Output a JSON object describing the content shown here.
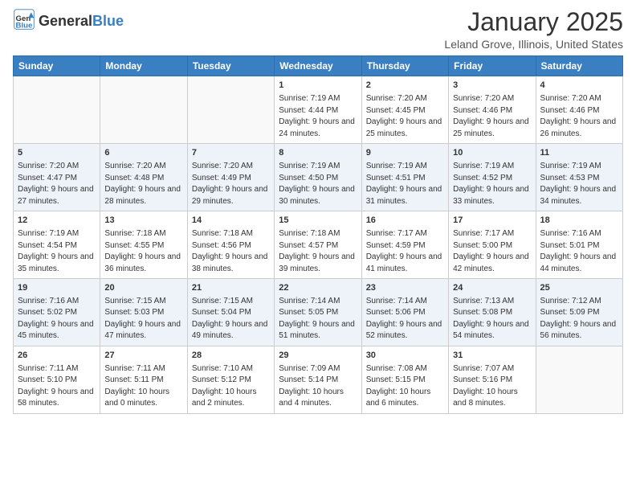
{
  "logo": {
    "general": "General",
    "blue": "Blue"
  },
  "header": {
    "month": "January 2025",
    "location": "Leland Grove, Illinois, United States"
  },
  "weekdays": [
    "Sunday",
    "Monday",
    "Tuesday",
    "Wednesday",
    "Thursday",
    "Friday",
    "Saturday"
  ],
  "weeks": [
    [
      {
        "day": "",
        "sunrise": "",
        "sunset": "",
        "daylight": "",
        "empty": true
      },
      {
        "day": "",
        "sunrise": "",
        "sunset": "",
        "daylight": "",
        "empty": true
      },
      {
        "day": "",
        "sunrise": "",
        "sunset": "",
        "daylight": "",
        "empty": true
      },
      {
        "day": "1",
        "sunrise": "Sunrise: 7:19 AM",
        "sunset": "Sunset: 4:44 PM",
        "daylight": "Daylight: 9 hours and 24 minutes.",
        "empty": false
      },
      {
        "day": "2",
        "sunrise": "Sunrise: 7:20 AM",
        "sunset": "Sunset: 4:45 PM",
        "daylight": "Daylight: 9 hours and 25 minutes.",
        "empty": false
      },
      {
        "day": "3",
        "sunrise": "Sunrise: 7:20 AM",
        "sunset": "Sunset: 4:46 PM",
        "daylight": "Daylight: 9 hours and 25 minutes.",
        "empty": false
      },
      {
        "day": "4",
        "sunrise": "Sunrise: 7:20 AM",
        "sunset": "Sunset: 4:46 PM",
        "daylight": "Daylight: 9 hours and 26 minutes.",
        "empty": false
      }
    ],
    [
      {
        "day": "5",
        "sunrise": "Sunrise: 7:20 AM",
        "sunset": "Sunset: 4:47 PM",
        "daylight": "Daylight: 9 hours and 27 minutes.",
        "empty": false
      },
      {
        "day": "6",
        "sunrise": "Sunrise: 7:20 AM",
        "sunset": "Sunset: 4:48 PM",
        "daylight": "Daylight: 9 hours and 28 minutes.",
        "empty": false
      },
      {
        "day": "7",
        "sunrise": "Sunrise: 7:20 AM",
        "sunset": "Sunset: 4:49 PM",
        "daylight": "Daylight: 9 hours and 29 minutes.",
        "empty": false
      },
      {
        "day": "8",
        "sunrise": "Sunrise: 7:19 AM",
        "sunset": "Sunset: 4:50 PM",
        "daylight": "Daylight: 9 hours and 30 minutes.",
        "empty": false
      },
      {
        "day": "9",
        "sunrise": "Sunrise: 7:19 AM",
        "sunset": "Sunset: 4:51 PM",
        "daylight": "Daylight: 9 hours and 31 minutes.",
        "empty": false
      },
      {
        "day": "10",
        "sunrise": "Sunrise: 7:19 AM",
        "sunset": "Sunset: 4:52 PM",
        "daylight": "Daylight: 9 hours and 33 minutes.",
        "empty": false
      },
      {
        "day": "11",
        "sunrise": "Sunrise: 7:19 AM",
        "sunset": "Sunset: 4:53 PM",
        "daylight": "Daylight: 9 hours and 34 minutes.",
        "empty": false
      }
    ],
    [
      {
        "day": "12",
        "sunrise": "Sunrise: 7:19 AM",
        "sunset": "Sunset: 4:54 PM",
        "daylight": "Daylight: 9 hours and 35 minutes.",
        "empty": false
      },
      {
        "day": "13",
        "sunrise": "Sunrise: 7:18 AM",
        "sunset": "Sunset: 4:55 PM",
        "daylight": "Daylight: 9 hours and 36 minutes.",
        "empty": false
      },
      {
        "day": "14",
        "sunrise": "Sunrise: 7:18 AM",
        "sunset": "Sunset: 4:56 PM",
        "daylight": "Daylight: 9 hours and 38 minutes.",
        "empty": false
      },
      {
        "day": "15",
        "sunrise": "Sunrise: 7:18 AM",
        "sunset": "Sunset: 4:57 PM",
        "daylight": "Daylight: 9 hours and 39 minutes.",
        "empty": false
      },
      {
        "day": "16",
        "sunrise": "Sunrise: 7:17 AM",
        "sunset": "Sunset: 4:59 PM",
        "daylight": "Daylight: 9 hours and 41 minutes.",
        "empty": false
      },
      {
        "day": "17",
        "sunrise": "Sunrise: 7:17 AM",
        "sunset": "Sunset: 5:00 PM",
        "daylight": "Daylight: 9 hours and 42 minutes.",
        "empty": false
      },
      {
        "day": "18",
        "sunrise": "Sunrise: 7:16 AM",
        "sunset": "Sunset: 5:01 PM",
        "daylight": "Daylight: 9 hours and 44 minutes.",
        "empty": false
      }
    ],
    [
      {
        "day": "19",
        "sunrise": "Sunrise: 7:16 AM",
        "sunset": "Sunset: 5:02 PM",
        "daylight": "Daylight: 9 hours and 45 minutes.",
        "empty": false
      },
      {
        "day": "20",
        "sunrise": "Sunrise: 7:15 AM",
        "sunset": "Sunset: 5:03 PM",
        "daylight": "Daylight: 9 hours and 47 minutes.",
        "empty": false
      },
      {
        "day": "21",
        "sunrise": "Sunrise: 7:15 AM",
        "sunset": "Sunset: 5:04 PM",
        "daylight": "Daylight: 9 hours and 49 minutes.",
        "empty": false
      },
      {
        "day": "22",
        "sunrise": "Sunrise: 7:14 AM",
        "sunset": "Sunset: 5:05 PM",
        "daylight": "Daylight: 9 hours and 51 minutes.",
        "empty": false
      },
      {
        "day": "23",
        "sunrise": "Sunrise: 7:14 AM",
        "sunset": "Sunset: 5:06 PM",
        "daylight": "Daylight: 9 hours and 52 minutes.",
        "empty": false
      },
      {
        "day": "24",
        "sunrise": "Sunrise: 7:13 AM",
        "sunset": "Sunset: 5:08 PM",
        "daylight": "Daylight: 9 hours and 54 minutes.",
        "empty": false
      },
      {
        "day": "25",
        "sunrise": "Sunrise: 7:12 AM",
        "sunset": "Sunset: 5:09 PM",
        "daylight": "Daylight: 9 hours and 56 minutes.",
        "empty": false
      }
    ],
    [
      {
        "day": "26",
        "sunrise": "Sunrise: 7:11 AM",
        "sunset": "Sunset: 5:10 PM",
        "daylight": "Daylight: 9 hours and 58 minutes.",
        "empty": false
      },
      {
        "day": "27",
        "sunrise": "Sunrise: 7:11 AM",
        "sunset": "Sunset: 5:11 PM",
        "daylight": "Daylight: 10 hours and 0 minutes.",
        "empty": false
      },
      {
        "day": "28",
        "sunrise": "Sunrise: 7:10 AM",
        "sunset": "Sunset: 5:12 PM",
        "daylight": "Daylight: 10 hours and 2 minutes.",
        "empty": false
      },
      {
        "day": "29",
        "sunrise": "Sunrise: 7:09 AM",
        "sunset": "Sunset: 5:14 PM",
        "daylight": "Daylight: 10 hours and 4 minutes.",
        "empty": false
      },
      {
        "day": "30",
        "sunrise": "Sunrise: 7:08 AM",
        "sunset": "Sunset: 5:15 PM",
        "daylight": "Daylight: 10 hours and 6 minutes.",
        "empty": false
      },
      {
        "day": "31",
        "sunrise": "Sunrise: 7:07 AM",
        "sunset": "Sunset: 5:16 PM",
        "daylight": "Daylight: 10 hours and 8 minutes.",
        "empty": false
      },
      {
        "day": "",
        "sunrise": "",
        "sunset": "",
        "daylight": "",
        "empty": true
      }
    ]
  ]
}
